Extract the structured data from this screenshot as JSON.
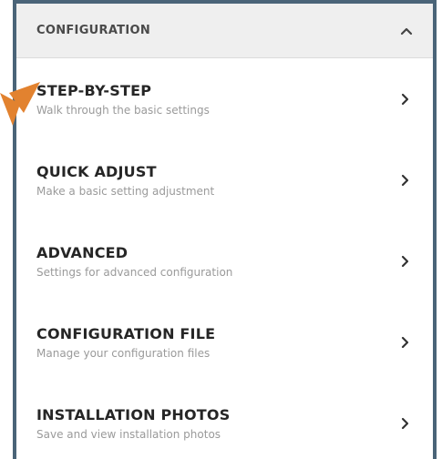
{
  "panel": {
    "title": "CONFIGURATION",
    "collapse_icon": "chevron-up-icon"
  },
  "items": [
    {
      "title": "STEP-BY-STEP",
      "subtitle": "Walk through the basic settings",
      "icon": "chevron-right-icon"
    },
    {
      "title": "QUICK ADJUST",
      "subtitle": "Make a basic setting adjustment",
      "icon": "chevron-right-icon"
    },
    {
      "title": "ADVANCED",
      "subtitle": "Settings for advanced configuration",
      "icon": "chevron-right-icon"
    },
    {
      "title": "CONFIGURATION FILE",
      "subtitle": "Manage your configuration files",
      "icon": "chevron-right-icon"
    },
    {
      "title": "INSTALLATION PHOTOS",
      "subtitle": "Save and view installation photos",
      "icon": "chevron-right-icon"
    }
  ],
  "colors": {
    "border": "#4a6478",
    "header_bg": "#efefef",
    "pointer": "#e2822f",
    "title_text": "#262626",
    "subtitle_text": "#9a9a9a"
  }
}
